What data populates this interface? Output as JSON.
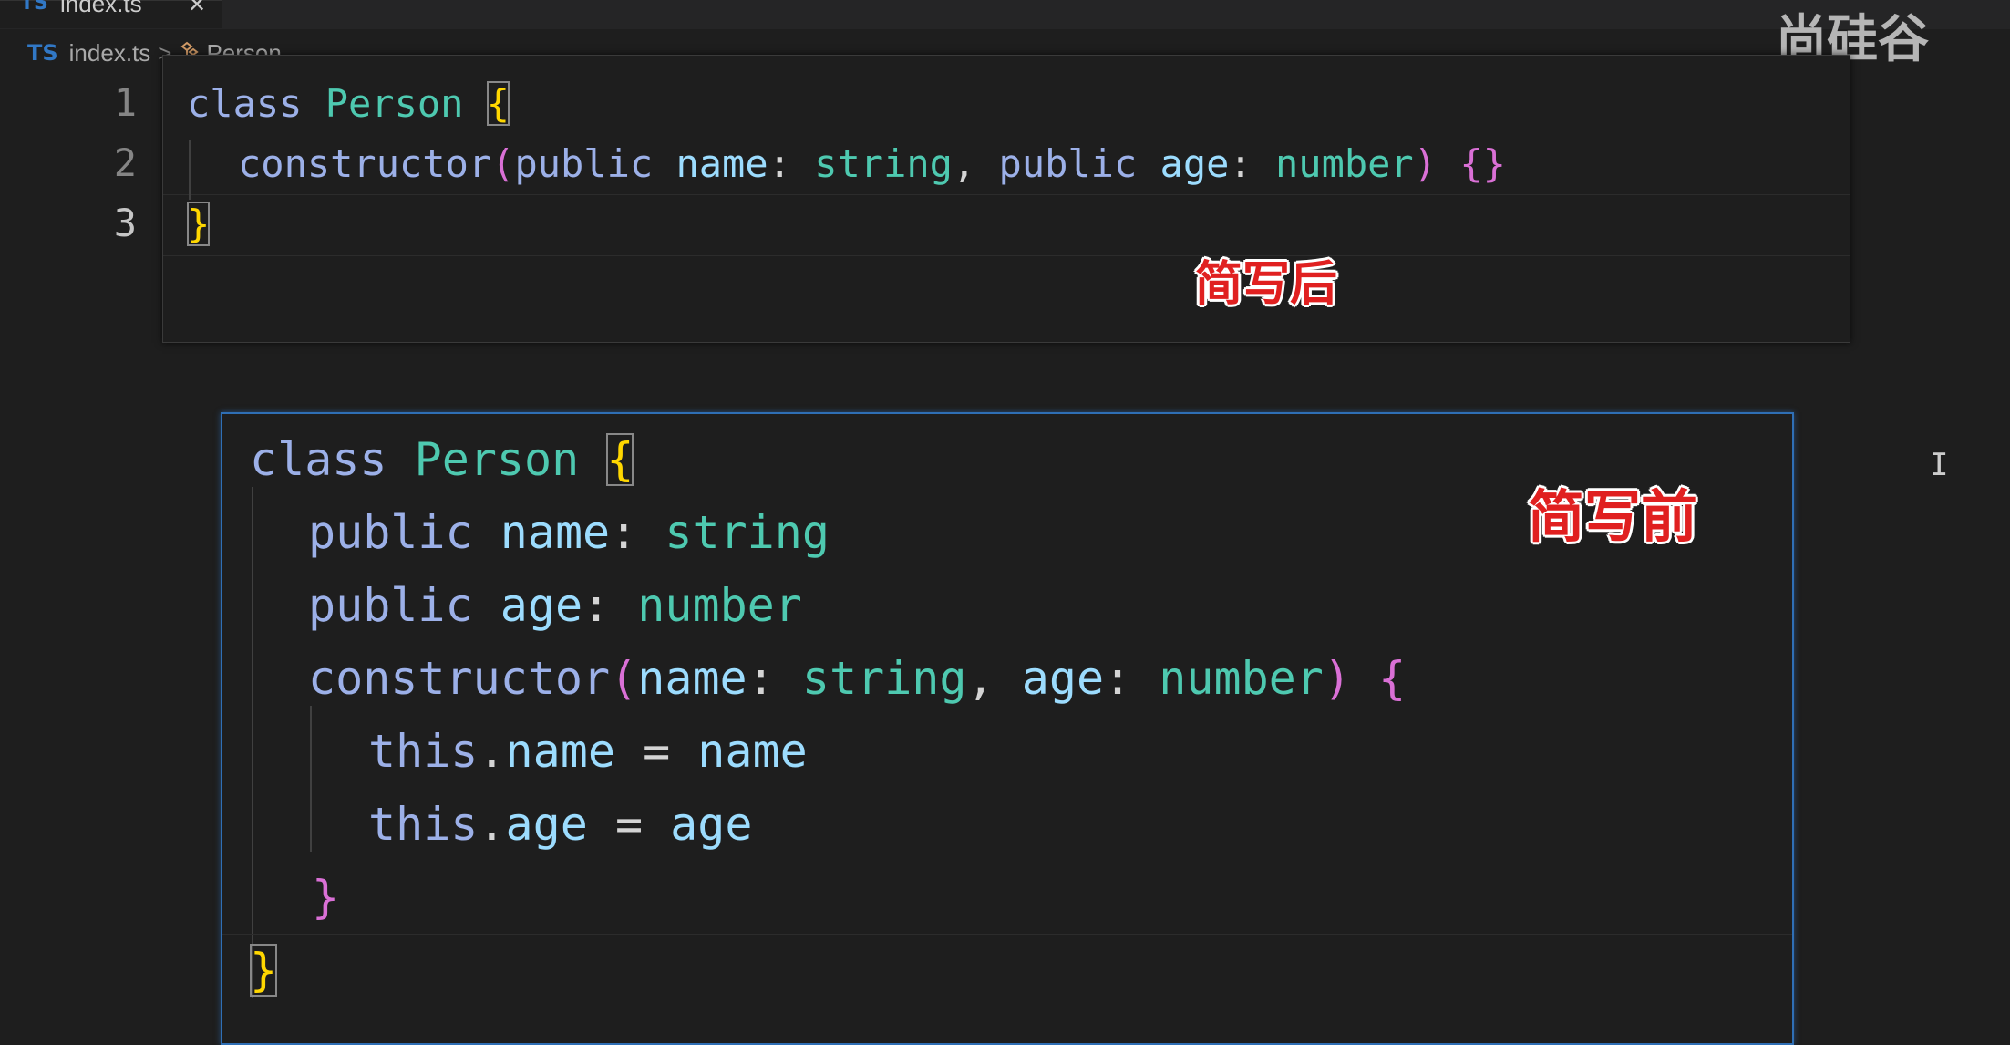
{
  "tab": {
    "lang": "TS",
    "name": "index.ts",
    "close": "✕"
  },
  "breadcrumb": {
    "lang": "TS",
    "file": "index.ts",
    "separator": ">",
    "symbol": "Person"
  },
  "watermark": "尚硅谷",
  "line_numbers": [
    "1",
    "2",
    "3"
  ],
  "labels": {
    "after": "简写后",
    "before": "简写前"
  },
  "after_code": {
    "l1": {
      "kw": "class",
      "name": "Person",
      "brace": "{"
    },
    "l2": {
      "ctor": "constructor",
      "open": "(",
      "pub1": "public",
      "p1": "name",
      "colon1": ":",
      "t1": "string",
      "comma": ",",
      "pub2": "public",
      "p2": "age",
      "colon2": ":",
      "t2": "number",
      "close": ")",
      "body": "{}"
    },
    "l3": {
      "brace": "}"
    }
  },
  "before_code": {
    "l1": {
      "kw": "class",
      "name": "Person",
      "brace": "{"
    },
    "l2": {
      "pub": "public",
      "prop": "name",
      "colon": ":",
      "type": "string"
    },
    "l3": {
      "pub": "public",
      "prop": "age",
      "colon": ":",
      "type": "number"
    },
    "l4": {
      "ctor": "constructor",
      "open": "(",
      "p1": "name",
      "colon1": ":",
      "t1": "string",
      "comma": ",",
      "p2": "age",
      "colon2": ":",
      "t2": "number",
      "close": ")",
      "brace": "{"
    },
    "l5": {
      "this": "this",
      "dot": ".",
      "prop": "name",
      "eq": "=",
      "val": "name"
    },
    "l6": {
      "this": "this",
      "dot": ".",
      "prop": "age",
      "eq": "=",
      "val": "age"
    },
    "l7": {
      "brace": "}"
    },
    "l8": {
      "brace": "}"
    }
  },
  "cursor": "I"
}
